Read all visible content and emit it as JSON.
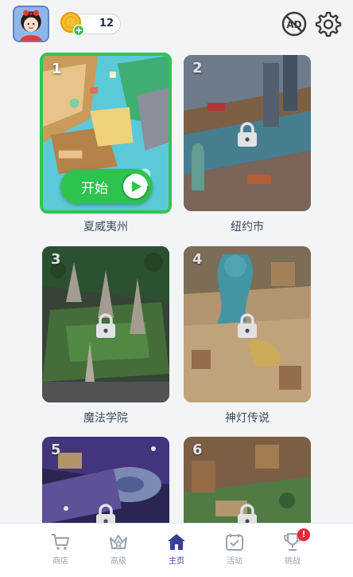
{
  "header": {
    "coin_count": "12"
  },
  "levels": [
    {
      "number": "1",
      "title": "夏威夷州",
      "locked": false
    },
    {
      "number": "2",
      "title": "纽约市",
      "locked": true
    },
    {
      "number": "3",
      "title": "魔法学院",
      "locked": true
    },
    {
      "number": "4",
      "title": "神灯传说",
      "locked": true
    },
    {
      "number": "5",
      "title": "",
      "locked": true
    },
    {
      "number": "6",
      "title": "",
      "locked": true
    }
  ],
  "start_button": {
    "label": "开始"
  },
  "nav": {
    "items": [
      {
        "label": "商店",
        "icon": "cart-icon"
      },
      {
        "label": "高级",
        "icon": "crown-icon"
      },
      {
        "label": "主页",
        "icon": "home-icon",
        "active": true
      },
      {
        "label": "活动",
        "icon": "calendar-icon"
      },
      {
        "label": "挑战",
        "icon": "trophy-icon",
        "badge": "!"
      }
    ]
  },
  "colors": {
    "accent_green": "#2ec24f",
    "nav_active": "#3b3f9a",
    "badge_red": "#e8283a"
  }
}
